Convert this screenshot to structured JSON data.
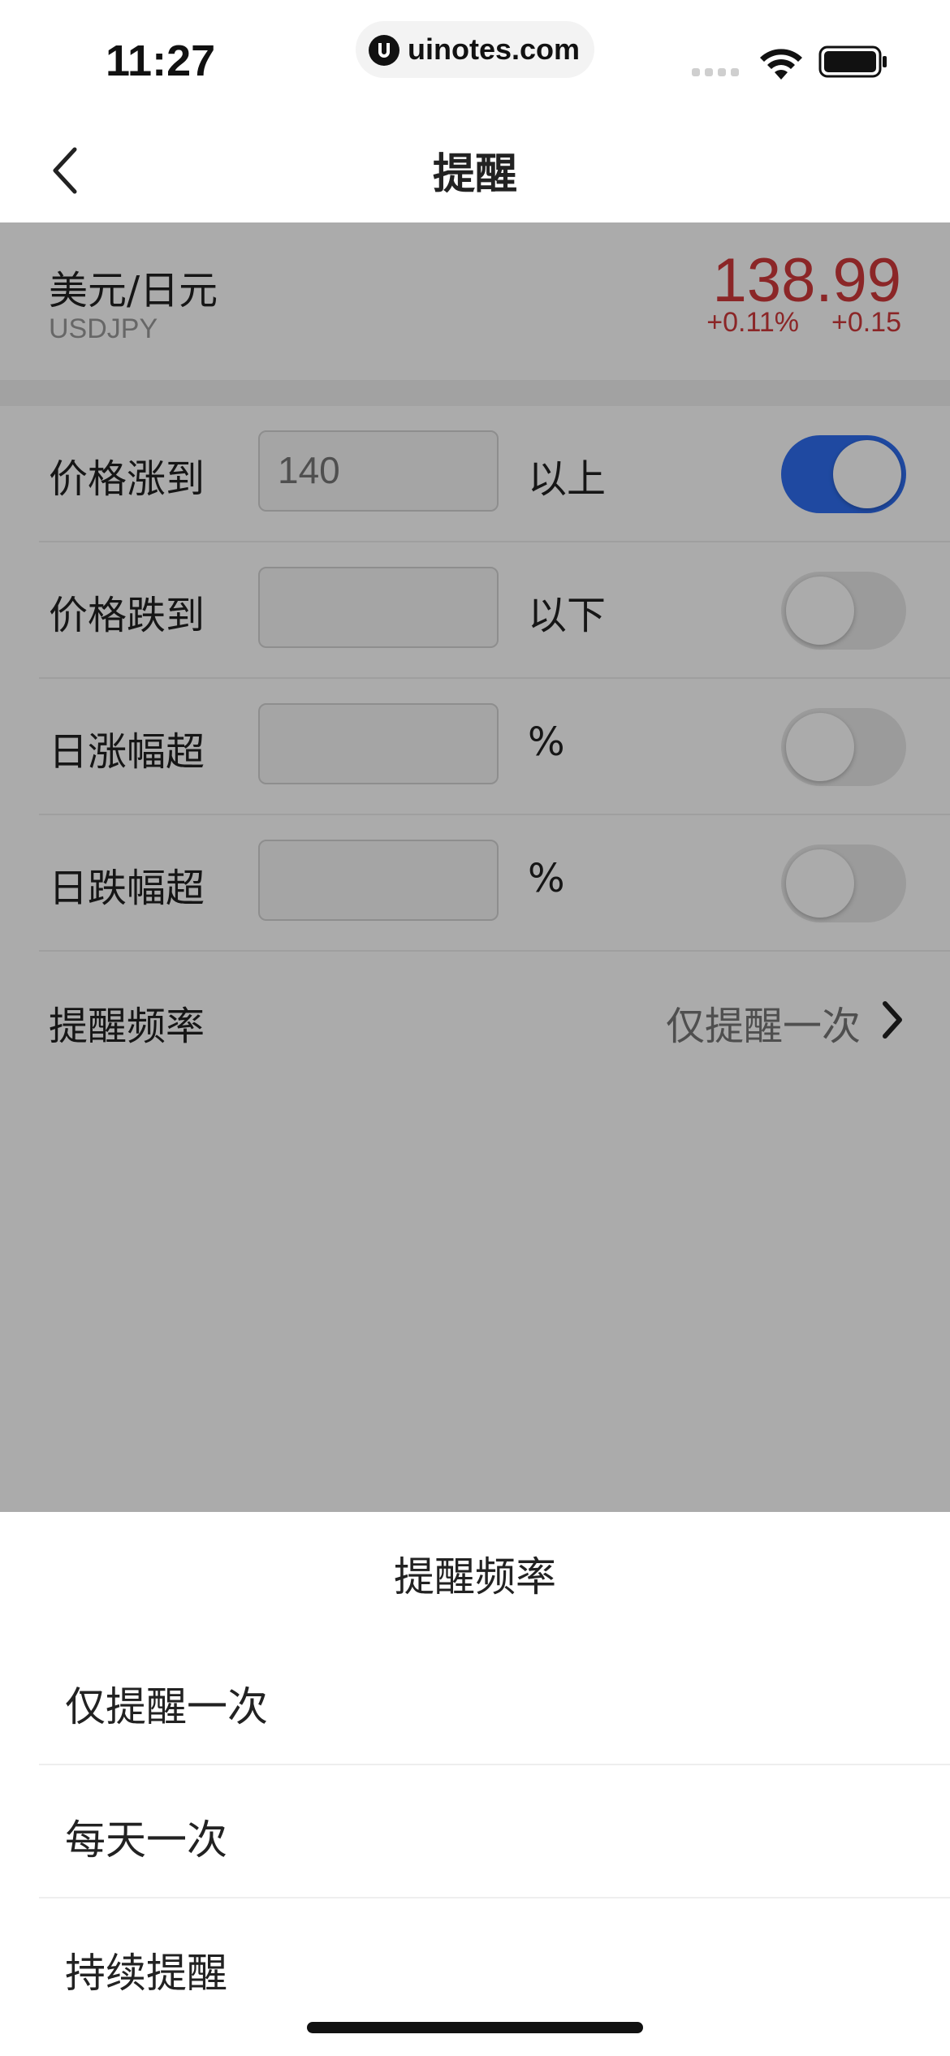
{
  "status_bar": {
    "time": "11:27",
    "url": "uinotes.com"
  },
  "nav": {
    "title": "提醒"
  },
  "quote": {
    "pair_name": "美元/日元",
    "pair_code": "USDJPY",
    "price": "138.99",
    "change_pct": "+0.11%",
    "change_value": "+0.15",
    "price_color": "#d0393b"
  },
  "alerts": [
    {
      "label": "价格涨到",
      "value": "140",
      "suffix": "以上",
      "enabled": true
    },
    {
      "label": "价格跌到",
      "value": "",
      "suffix": "以下",
      "enabled": false
    },
    {
      "label": "日涨幅超",
      "value": "",
      "suffix": "%",
      "enabled": false
    },
    {
      "label": "日跌幅超",
      "value": "",
      "suffix": "%",
      "enabled": false
    }
  ],
  "frequency": {
    "label": "提醒频率",
    "value": "仅提醒一次"
  },
  "sheet": {
    "title": "提醒频率",
    "options": [
      "仅提醒一次",
      "每天一次",
      "持续提醒"
    ]
  },
  "colors": {
    "toggle_on": "#2f6ef0",
    "accent_red": "#d0393b"
  },
  "icons": {
    "back": "chevron-left-icon",
    "chevron": "chevron-right-icon"
  }
}
